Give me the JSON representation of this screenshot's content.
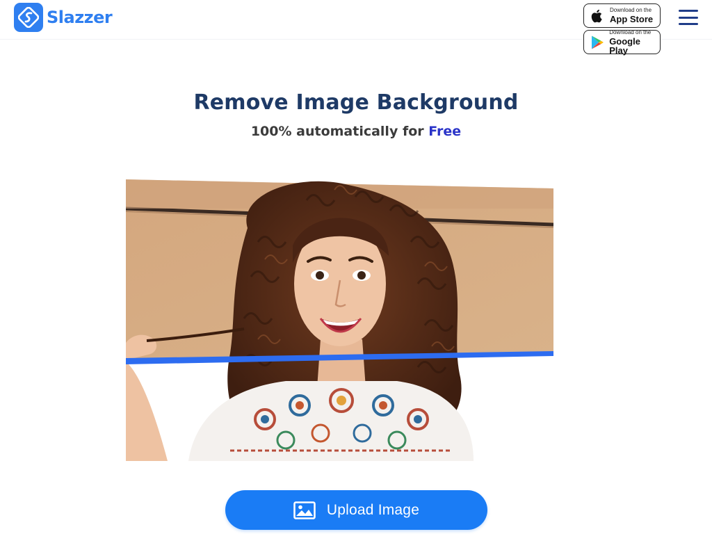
{
  "header": {
    "logo_text": "Slazzer",
    "app_store": {
      "small": "Download on the",
      "big": "App Store"
    },
    "google_play": {
      "small": "Download on the",
      "big": "Google Play"
    }
  },
  "hero": {
    "title": "Remove Image Background",
    "subtitle_prefix": "100% automatically for ",
    "subtitle_highlight": "Free"
  },
  "upload": {
    "label": "Upload Image"
  },
  "icons": {
    "logo": "slazzer-logo-icon",
    "app_store": "apple-icon",
    "google_play": "google-play-icon",
    "menu": "hamburger-menu-icon",
    "upload": "image-icon"
  },
  "colors": {
    "brand_blue": "#2f7ff0",
    "button_blue": "#1a7cf5",
    "title_navy": "#1e3a66",
    "free_blue": "#2a33c8",
    "scan_line": "#2d6cf0"
  }
}
